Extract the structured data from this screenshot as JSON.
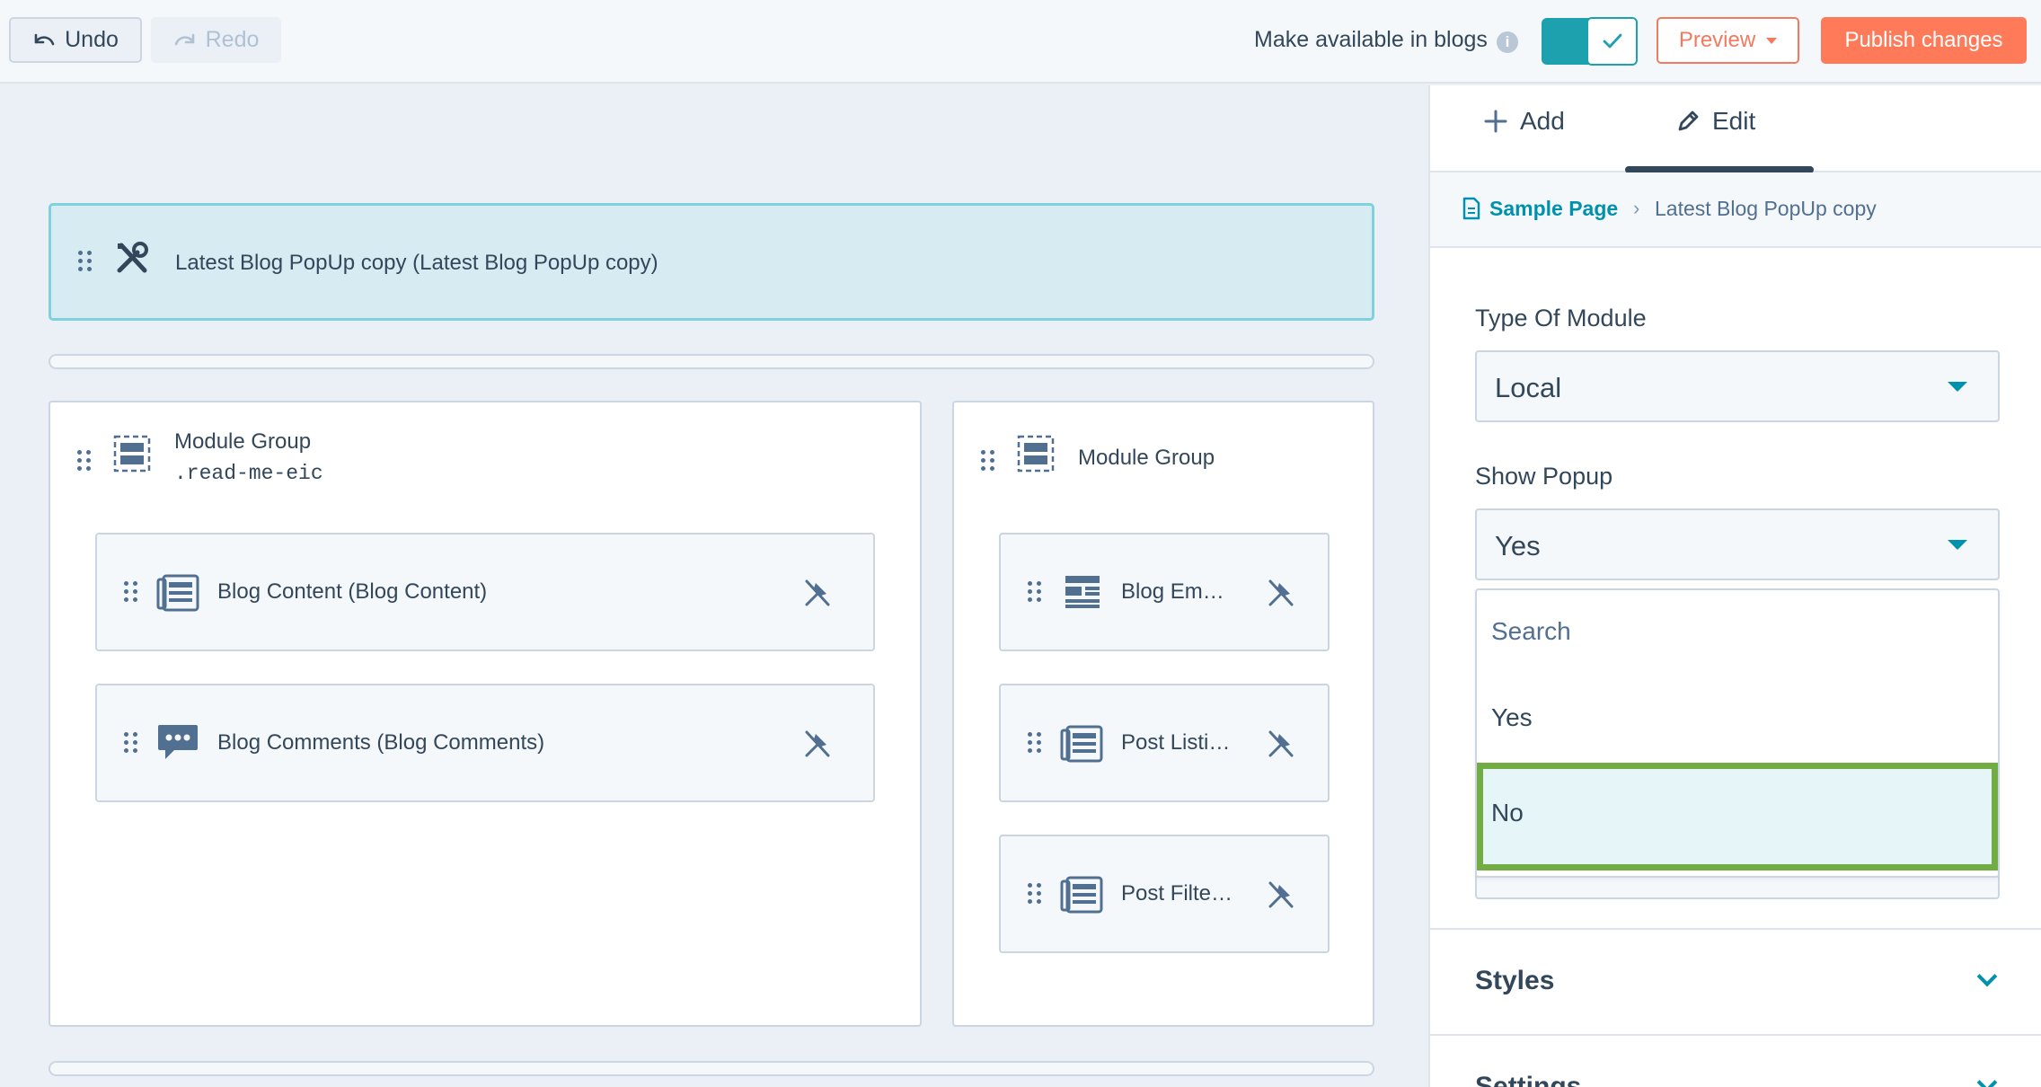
{
  "toolbar": {
    "undo_label": "Undo",
    "redo_label": "Redo",
    "available_label": "Make available in blogs",
    "preview_label": "Preview",
    "publish_label": "Publish changes"
  },
  "canvas": {
    "selected_module": "Latest Blog PopUp copy (Latest Blog PopUp copy)",
    "group_left": {
      "title": "Module Group",
      "class_name": ".read-me-eic",
      "cards": [
        "Blog Content (Blog Content)",
        "Blog Comments (Blog Comments)"
      ]
    },
    "group_right": {
      "title": "Module Group",
      "cards": [
        "Blog Em…",
        "Post Listi…",
        "Post Filte…"
      ]
    }
  },
  "panel": {
    "tabs": {
      "add": "Add",
      "edit": "Edit"
    },
    "breadcrumb": {
      "page": "Sample Page",
      "separator": "›",
      "current": "Latest Blog PopUp copy"
    },
    "type_of_module": {
      "label": "Type Of Module",
      "value": "Local"
    },
    "show_popup": {
      "label": "Show Popup",
      "value": "Yes",
      "search_placeholder": "Search",
      "options": [
        "Yes",
        "No"
      ],
      "highlighted": "No"
    },
    "sections": {
      "styles": "Styles",
      "settings": "Settings"
    }
  },
  "colors": {
    "accent_teal": "#0091ae",
    "publish_orange": "#ff7a59",
    "highlight_green": "#72ad43",
    "selected_module_bg": "#d6ebf2"
  }
}
